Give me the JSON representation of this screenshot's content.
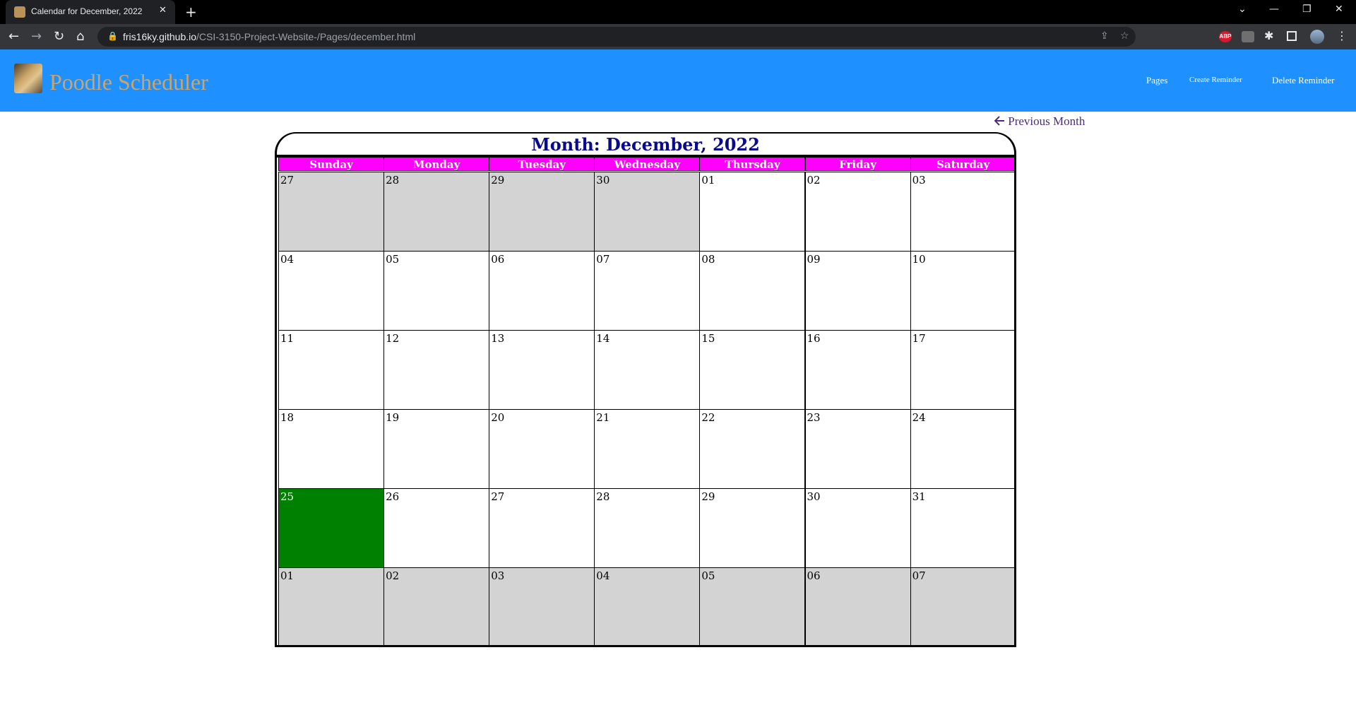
{
  "browser": {
    "tab_title": "Calendar for December, 2022",
    "tab_close": "✕",
    "new_tab": "+",
    "url_host": "fris16ky.github.io",
    "url_path": "/CSI-3150-Project-Website-/Pages/december.html",
    "back": "←",
    "forward": "→",
    "reload": "↻",
    "home": "⌂",
    "lock": "🔒",
    "share": "⇪",
    "star": "☆",
    "ext_abp": "ABP",
    "puzzle": "✱",
    "menu": "⋮",
    "win_chevron": "⌄",
    "win_min": "—",
    "win_restore": "❐",
    "win_close": "✕"
  },
  "site": {
    "brand": "Poodle Scheduler",
    "nav": {
      "pages": "Pages",
      "create_reminder": "Create Reminder",
      "delete_reminder": "Delete Reminder"
    }
  },
  "calendar": {
    "prev_month_label": "Previous Month",
    "prev_month_icon": "arrow-left-icon",
    "title": "Month: December, 2022",
    "weekdays": [
      "Sunday",
      "Monday",
      "Tuesday",
      "Wednesday",
      "Thursday",
      "Friday",
      "Saturday"
    ],
    "weeks": [
      [
        {
          "d": "27",
          "s": "other"
        },
        {
          "d": "28",
          "s": "other"
        },
        {
          "d": "29",
          "s": "other"
        },
        {
          "d": "30",
          "s": "other"
        },
        {
          "d": "01",
          "s": ""
        },
        {
          "d": "02",
          "s": ""
        },
        {
          "d": "03",
          "s": ""
        }
      ],
      [
        {
          "d": "04",
          "s": ""
        },
        {
          "d": "05",
          "s": ""
        },
        {
          "d": "06",
          "s": ""
        },
        {
          "d": "07",
          "s": ""
        },
        {
          "d": "08",
          "s": ""
        },
        {
          "d": "09",
          "s": ""
        },
        {
          "d": "10",
          "s": ""
        }
      ],
      [
        {
          "d": "11",
          "s": ""
        },
        {
          "d": "12",
          "s": ""
        },
        {
          "d": "13",
          "s": ""
        },
        {
          "d": "14",
          "s": ""
        },
        {
          "d": "15",
          "s": ""
        },
        {
          "d": "16",
          "s": ""
        },
        {
          "d": "17",
          "s": ""
        }
      ],
      [
        {
          "d": "18",
          "s": ""
        },
        {
          "d": "19",
          "s": ""
        },
        {
          "d": "20",
          "s": ""
        },
        {
          "d": "21",
          "s": ""
        },
        {
          "d": "22",
          "s": ""
        },
        {
          "d": "23",
          "s": ""
        },
        {
          "d": "24",
          "s": ""
        }
      ],
      [
        {
          "d": "25",
          "s": "today"
        },
        {
          "d": "26",
          "s": ""
        },
        {
          "d": "27",
          "s": ""
        },
        {
          "d": "28",
          "s": ""
        },
        {
          "d": "29",
          "s": ""
        },
        {
          "d": "30",
          "s": ""
        },
        {
          "d": "31",
          "s": ""
        }
      ],
      [
        {
          "d": "01",
          "s": "other"
        },
        {
          "d": "02",
          "s": "other"
        },
        {
          "d": "03",
          "s": "other"
        },
        {
          "d": "04",
          "s": "other"
        },
        {
          "d": "05",
          "s": "other"
        },
        {
          "d": "06",
          "s": "other"
        },
        {
          "d": "07",
          "s": "other"
        }
      ]
    ],
    "colors": {
      "header_bg": "#1e90ff",
      "brand": "#c9a56b",
      "weekday_bg": "#ff00ff",
      "title": "#0a0a8f",
      "other_month": "#d3d3d3",
      "highlight": "#008000"
    }
  }
}
